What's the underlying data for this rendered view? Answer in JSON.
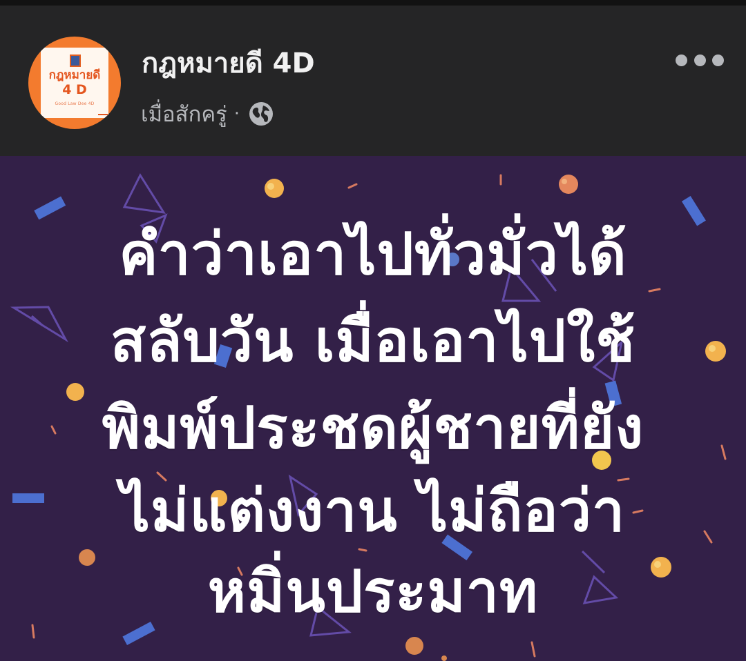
{
  "post": {
    "page_name": "กฎหมายดี 4D",
    "timestamp": "เมื่อสักครู่",
    "separator": "·",
    "privacy_icon": "globe-icon",
    "more_icon": "more-options-icon",
    "avatar": {
      "title": "กฎหมายดี",
      "subtitle": "4 D",
      "tagline": "Good Law Dee 4D"
    }
  },
  "image": {
    "lines": [
      "คำว่าเอาไปทั่วมั่วได้",
      "สลับวัน เมื่อเอาไปใช้",
      "พิมพ์ประชดผู้ชายที่ยัง",
      "ไม่แต่งงาน ไม่ถือว่า",
      "หมิ่นประมาท"
    ],
    "colors": {
      "background": "#332048",
      "text": "#ffffff",
      "header_bg": "#252526",
      "avatar_bg": "#f37b2e",
      "accent_orange": "#f0a25b",
      "accent_blue": "#5a78c8"
    }
  }
}
